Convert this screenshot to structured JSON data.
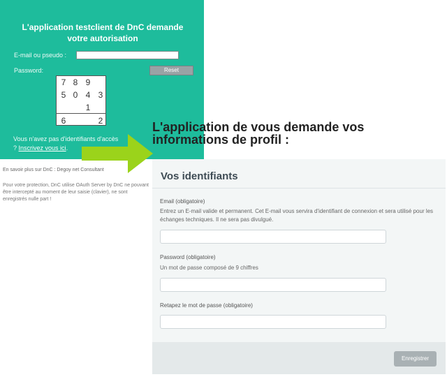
{
  "auth_panel": {
    "title_line1": "L'application testclient de DnC demande",
    "title_line2": "votre autorisation",
    "email_label": "E-mail ou pseudo :",
    "password_label": "Password:",
    "reset_label": "Reset",
    "keypad": [
      "7",
      "8",
      "9",
      "5",
      "0",
      "4",
      "3",
      "1",
      "6",
      "2"
    ],
    "no_access_text": "Vous n'avez pas d'identifiants d'accès",
    "question_mark": "?",
    "register_link": "Inscrivez vous ici",
    "register_period": "."
  },
  "info": {
    "learn_more": "En savoir plus sur DnC : Degoy net Consultant",
    "protection": "Pour votre protection, DnC utilise OAuth Server by DnC ne pouvant être intercepté au moment de leur saisie (clavier), ne sont enregistrés nulle part !"
  },
  "headline": {
    "line1": "L'application  de  vous demande vos",
    "line2": "informations de profil :"
  },
  "form": {
    "title": "Vos identifiants",
    "email_label": "Email (obligatoire)",
    "email_help": "Entrez un E-mail valide et permanent. Cet E-mail vous servira d'identifiant de connexion et sera utilisé pour les échanges techniques. Il ne sera pas divulgué.",
    "password_label": "Password (obligatoire)",
    "password_help": "Un mot de passe composé de 9 chiffres",
    "confirm_label": "Retapez le mot de passe (obligatoire)",
    "submit_label": "Enregistrer"
  },
  "colors": {
    "auth_bg": "#1ebc9c",
    "arrow": "#9bd31b",
    "form_bg": "#f3f6f6"
  }
}
